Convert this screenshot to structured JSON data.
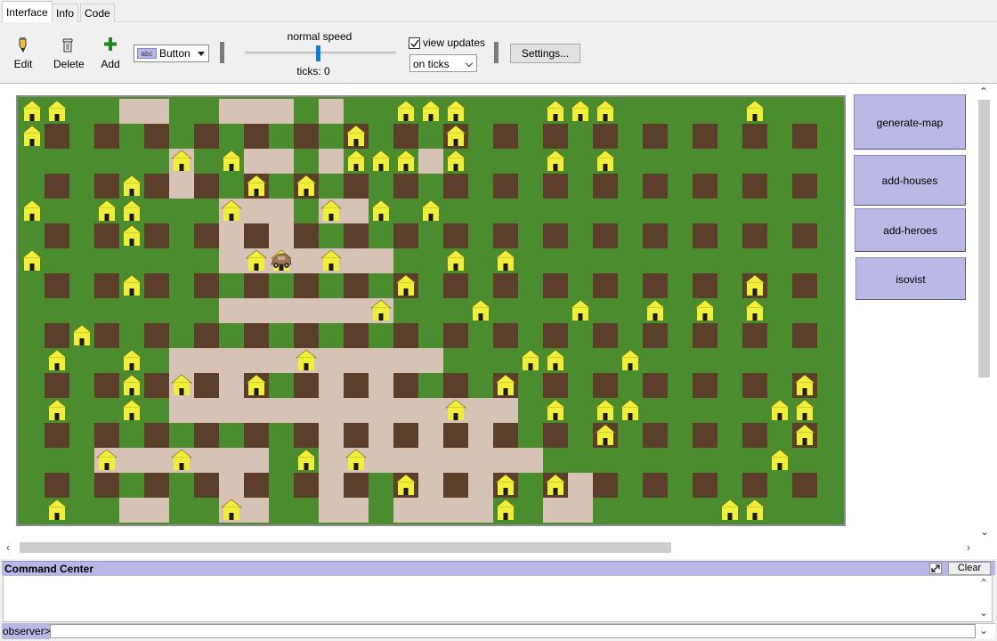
{
  "tabs": [
    {
      "label": "Interface",
      "active": true
    },
    {
      "label": "Info",
      "active": false
    },
    {
      "label": "Code",
      "active": false
    }
  ],
  "toolbar": {
    "edit_label": "Edit",
    "delete_label": "Delete",
    "add_label": "Add",
    "widget_type": "Button",
    "widget_icon_text": "abc",
    "speed_label": "normal speed",
    "speed_level": 0.5,
    "ticks_label": "ticks: 0",
    "view_updates_label": "view updates",
    "view_updates_checked": true,
    "update_mode": "on ticks",
    "settings_label": "Settings..."
  },
  "buttons": {
    "generate_map": "generate-map",
    "add_houses": "add-houses",
    "add_heroes": "add-heroes",
    "isovist": "isovist"
  },
  "world": {
    "colors": {
      "grass": "#4a8c2e",
      "road": "#d6c3b5",
      "building": "#5c3f2b",
      "house": "#f2ef3a"
    },
    "road_cells": [
      "4,0",
      "5,0",
      "8,0",
      "9,0",
      "10,0",
      "12,0",
      "5,1",
      "9,1",
      "6,2",
      "9,2",
      "10,2",
      "12,2",
      "16,2",
      "6,3",
      "15,3",
      "8,4",
      "9,4",
      "10,4",
      "12,4",
      "13,4",
      "8,5",
      "10,5",
      "13,5",
      "8,6",
      "9,6",
      "10,6",
      "11,6",
      "12,6",
      "13,6",
      "14,6",
      "11,7",
      "13,7",
      "8,8",
      "9,8",
      "10,8",
      "11,8",
      "12,8",
      "13,8",
      "14,8",
      "7,9",
      "9,9",
      "11,9",
      "13,9",
      "6,10",
      "7,10",
      "8,10",
      "9,10",
      "10,10",
      "11,10",
      "12,10",
      "13,10",
      "14,10",
      "15,10",
      "16,10",
      "6,11",
      "7,11",
      "8,11",
      "12,11",
      "13,11",
      "14,11",
      "15,11",
      "17,11",
      "6,12",
      "7,12",
      "8,12",
      "9,12",
      "10,12",
      "11,12",
      "12,12",
      "13,12",
      "14,12",
      "15,12",
      "16,12",
      "17,12",
      "18,12",
      "19,12",
      "5,13",
      "7,13",
      "9,13",
      "12,13",
      "14,13",
      "16,13",
      "18,13",
      "3,14",
      "4,14",
      "5,14",
      "6,14",
      "7,14",
      "8,14",
      "9,14",
      "12,14",
      "13,14",
      "14,14",
      "15,14",
      "16,14",
      "17,14",
      "18,14",
      "19,14",
      "20,14",
      "3,15",
      "8,15",
      "12,15",
      "16,15",
      "18,15",
      "22,15",
      "4,16",
      "5,16",
      "8,16",
      "9,16",
      "12,16",
      "13,16",
      "15,16",
      "16,16",
      "17,16",
      "18,16",
      "21,16",
      "22,16"
    ],
    "houses": [
      "0,0",
      "1,0",
      "15,0",
      "16,0",
      "17,0",
      "21,0",
      "22,0",
      "23,0",
      "29,0",
      "0,1",
      "13,1",
      "17,1",
      "6,2",
      "8,2",
      "13,2",
      "14,2",
      "15,2",
      "17,2",
      "21,2",
      "23,2",
      "4,3",
      "9,3",
      "11,3",
      "0,4",
      "3,4",
      "4,4",
      "8,4",
      "12,4",
      "14,4",
      "16,4",
      "4,5",
      "0,6",
      "9,6",
      "10,6",
      "12,6",
      "17,6",
      "19,6",
      "4,7",
      "15,7",
      "29,7",
      "14,8",
      "18,8",
      "22,8",
      "25,8",
      "27,8",
      "29,8",
      "2,9",
      "1,10",
      "4,10",
      "11,10",
      "20,10",
      "21,10",
      "24,10",
      "4,11",
      "6,11",
      "9,11",
      "19,11",
      "31,11",
      "1,12",
      "4,12",
      "17,12",
      "21,12",
      "23,12",
      "24,12",
      "30,12",
      "31,12",
      "23,13",
      "31,13",
      "3,14",
      "6,14",
      "11,14",
      "13,14",
      "30,14",
      "15,15",
      "19,15",
      "21,15",
      "33,15",
      "1,16",
      "8,16",
      "19,16",
      "28,16",
      "29,16"
    ],
    "hero": "10,6"
  }
}
